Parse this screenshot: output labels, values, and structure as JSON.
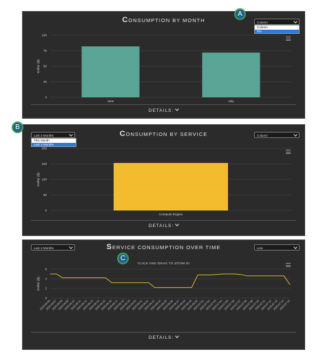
{
  "callouts": {
    "a": "A",
    "b": "B",
    "c": "C"
  },
  "details_label": "DETAILS:",
  "panel1": {
    "title_first": "C",
    "title_rest": "ONSUMPTION BY MONTH",
    "chart_type_select": "Column",
    "chart_type_options": [
      "Column",
      "Pie"
    ],
    "chart_type_highlighted": "Pie"
  },
  "panel2": {
    "title_first": "C",
    "title_rest": "ONSUMPTION BY SERVICE",
    "range_select": "Last 3 Months",
    "range_options": [
      "This Month",
      "Last 3 Months"
    ],
    "range_highlighted": "Last 3 Months",
    "chart_type_select": "Column"
  },
  "panel3": {
    "title_first": "S",
    "title_rest": "ERVICE CONSUMPTION OVER TIME",
    "range_select": "Last 3 Months",
    "chart_type_select": "Line",
    "zoom_hint": "Click and drag to zoom in"
  },
  "colors": {
    "bar_month": "#5aa595",
    "bar_service": "#f3bb2e",
    "line": "#e0b032"
  },
  "chart_data": [
    {
      "type": "bar",
      "title": "Consumption by Month",
      "categories": [
        "June",
        "July"
      ],
      "series": [
        {
          "values": [
            82,
            72
          ]
        }
      ],
      "ylabel": "Dollar ($)",
      "ylim": [
        0,
        100
      ],
      "yticks": [
        "0",
        "25",
        "50",
        "75",
        "100"
      ],
      "grid": true
    },
    {
      "type": "bar",
      "title": "Consumption by Service",
      "categories": [
        "Compute Engine"
      ],
      "series": [
        {
          "values": [
            153
          ]
        }
      ],
      "ylabel": "Dollar ($)",
      "ylim": [
        0,
        200
      ],
      "yticks": [
        "0",
        "50",
        "100",
        "150",
        "200"
      ],
      "grid": true
    },
    {
      "type": "line",
      "title": "Service Consumption over Time",
      "x": [
        "2020-06-06",
        "2020-06-07",
        "2020-06-08",
        "2020-06-09",
        "2020-06-10",
        "2020-06-11",
        "2020-06-12",
        "2020-06-13",
        "2020-06-14",
        "2020-06-15",
        "2020-06-16",
        "2020-06-17",
        "2020-06-18",
        "2020-06-19",
        "2020-06-20",
        "2020-06-21",
        "2020-06-22",
        "2020-06-23",
        "2020-06-24",
        "2020-06-25",
        "2020-06-26",
        "2020-06-27",
        "2020-06-28",
        "2020-06-29",
        "2020-06-30",
        "2020-07-01",
        "2020-07-02",
        "2020-07-03",
        "2020-07-04",
        "2020-07-05",
        "2020-07-06",
        "2020-07-07",
        "2020-07-08",
        "2020-07-09",
        "2020-07-10",
        "2020-07-11",
        "2020-07-12",
        "2020-07-13",
        "2020-07-14",
        "2020-07-15"
      ],
      "series": [
        {
          "values": [
            5.0,
            5.0,
            4.2,
            4.2,
            4.2,
            4.2,
            4.2,
            4.2,
            4.2,
            4.2,
            3.2,
            3.2,
            3.2,
            3.2,
            3.2,
            3.2,
            3.2,
            2.2,
            2.2,
            2.2,
            2.2,
            2.2,
            2.2,
            2.2,
            4.8,
            4.8,
            4.8,
            4.9,
            5.0,
            5.0,
            5.0,
            4.9,
            4.6,
            4.6,
            4.6,
            4.6,
            4.6,
            4.6,
            4.6,
            2.8
          ]
        }
      ],
      "ylabel": "Dollar ($)",
      "ylim": [
        0,
        6
      ],
      "yticks": [
        "0",
        "2",
        "4",
        "6"
      ],
      "grid": true
    }
  ]
}
